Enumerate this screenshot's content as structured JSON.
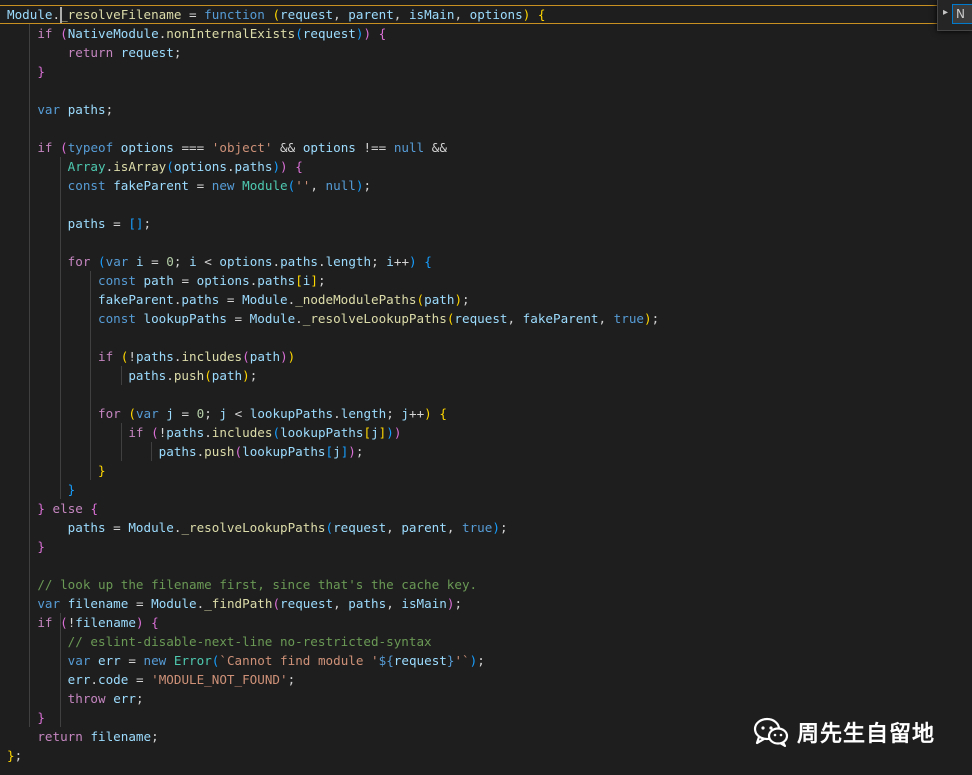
{
  "editor": {
    "language": "javascript",
    "theme_background": "#1e1e1e",
    "current_line_border": "#c89020",
    "lines": [
      [
        [
          "vr",
          "Module"
        ],
        [
          "op",
          "."
        ],
        [
          "fn",
          "_resolveFilename"
        ],
        [
          "op",
          " = "
        ],
        [
          "kw",
          "function"
        ],
        [
          "op",
          " "
        ],
        [
          "p1",
          "("
        ],
        [
          "vr",
          "request"
        ],
        [
          "op",
          ", "
        ],
        [
          "vr",
          "parent"
        ],
        [
          "op",
          ", "
        ],
        [
          "vr",
          "isMain"
        ],
        [
          "op",
          ", "
        ],
        [
          "vr",
          "options"
        ],
        [
          "p1",
          ")"
        ],
        [
          "op",
          " "
        ],
        [
          "p1",
          "{"
        ]
      ],
      [
        [
          "op",
          "    "
        ],
        [
          "kc",
          "if"
        ],
        [
          "op",
          " "
        ],
        [
          "p2",
          "("
        ],
        [
          "vr",
          "NativeModule"
        ],
        [
          "op",
          "."
        ],
        [
          "fn",
          "nonInternalExists"
        ],
        [
          "p3",
          "("
        ],
        [
          "vr",
          "request"
        ],
        [
          "p3",
          ")"
        ],
        [
          "p2",
          ")"
        ],
        [
          "op",
          " "
        ],
        [
          "p2",
          "{"
        ]
      ],
      [
        [
          "op",
          "        "
        ],
        [
          "kc",
          "return"
        ],
        [
          "op",
          " "
        ],
        [
          "vr",
          "request"
        ],
        [
          "op",
          ";"
        ]
      ],
      [
        [
          "op",
          "    "
        ],
        [
          "p2",
          "}"
        ]
      ],
      [
        [
          "op",
          ""
        ]
      ],
      [
        [
          "op",
          "    "
        ],
        [
          "kw",
          "var"
        ],
        [
          "op",
          " "
        ],
        [
          "vr",
          "paths"
        ],
        [
          "op",
          ";"
        ]
      ],
      [
        [
          "op",
          ""
        ]
      ],
      [
        [
          "op",
          "    "
        ],
        [
          "kc",
          "if"
        ],
        [
          "op",
          " "
        ],
        [
          "p2",
          "("
        ],
        [
          "kw",
          "typeof"
        ],
        [
          "op",
          " "
        ],
        [
          "vr",
          "options"
        ],
        [
          "op",
          " === "
        ],
        [
          "st",
          "'object'"
        ],
        [
          "op",
          " && "
        ],
        [
          "vr",
          "options"
        ],
        [
          "op",
          " !== "
        ],
        [
          "kw",
          "null"
        ],
        [
          "op",
          " &&"
        ]
      ],
      [
        [
          "op",
          "        "
        ],
        [
          "ty",
          "Array"
        ],
        [
          "op",
          "."
        ],
        [
          "fn",
          "isArray"
        ],
        [
          "p3",
          "("
        ],
        [
          "vr",
          "options"
        ],
        [
          "op",
          "."
        ],
        [
          "vr",
          "paths"
        ],
        [
          "p3",
          ")"
        ],
        [
          "p2",
          ")"
        ],
        [
          "op",
          " "
        ],
        [
          "p2",
          "{"
        ]
      ],
      [
        [
          "op",
          "        "
        ],
        [
          "kw",
          "const"
        ],
        [
          "op",
          " "
        ],
        [
          "vr",
          "fakeParent"
        ],
        [
          "op",
          " = "
        ],
        [
          "kw",
          "new"
        ],
        [
          "op",
          " "
        ],
        [
          "ty",
          "Module"
        ],
        [
          "p3",
          "("
        ],
        [
          "st",
          "''"
        ],
        [
          "op",
          ", "
        ],
        [
          "kw",
          "null"
        ],
        [
          "p3",
          ")"
        ],
        [
          "op",
          ";"
        ]
      ],
      [
        [
          "op",
          ""
        ]
      ],
      [
        [
          "op",
          "        "
        ],
        [
          "vr",
          "paths"
        ],
        [
          "op",
          " = "
        ],
        [
          "p3",
          "[]"
        ],
        [
          "op",
          ";"
        ]
      ],
      [
        [
          "op",
          ""
        ]
      ],
      [
        [
          "op",
          "        "
        ],
        [
          "kc",
          "for"
        ],
        [
          "op",
          " "
        ],
        [
          "p3",
          "("
        ],
        [
          "kw",
          "var"
        ],
        [
          "op",
          " "
        ],
        [
          "vr",
          "i"
        ],
        [
          "op",
          " = "
        ],
        [
          "nm",
          "0"
        ],
        [
          "op",
          "; "
        ],
        [
          "vr",
          "i"
        ],
        [
          "op",
          " < "
        ],
        [
          "vr",
          "options"
        ],
        [
          "op",
          "."
        ],
        [
          "vr",
          "paths"
        ],
        [
          "op",
          "."
        ],
        [
          "vr",
          "length"
        ],
        [
          "op",
          "; "
        ],
        [
          "vr",
          "i"
        ],
        [
          "op",
          "++"
        ],
        [
          "p3",
          ")"
        ],
        [
          "op",
          " "
        ],
        [
          "p3",
          "{"
        ]
      ],
      [
        [
          "op",
          "            "
        ],
        [
          "kw",
          "const"
        ],
        [
          "op",
          " "
        ],
        [
          "vr",
          "path"
        ],
        [
          "op",
          " = "
        ],
        [
          "vr",
          "options"
        ],
        [
          "op",
          "."
        ],
        [
          "vr",
          "paths"
        ],
        [
          "p1",
          "["
        ],
        [
          "vr",
          "i"
        ],
        [
          "p1",
          "]"
        ],
        [
          "op",
          ";"
        ]
      ],
      [
        [
          "op",
          "            "
        ],
        [
          "vr",
          "fakeParent"
        ],
        [
          "op",
          "."
        ],
        [
          "vr",
          "paths"
        ],
        [
          "op",
          " = "
        ],
        [
          "vr",
          "Module"
        ],
        [
          "op",
          "."
        ],
        [
          "fn",
          "_nodeModulePaths"
        ],
        [
          "p1",
          "("
        ],
        [
          "vr",
          "path"
        ],
        [
          "p1",
          ")"
        ],
        [
          "op",
          ";"
        ]
      ],
      [
        [
          "op",
          "            "
        ],
        [
          "kw",
          "const"
        ],
        [
          "op",
          " "
        ],
        [
          "vr",
          "lookupPaths"
        ],
        [
          "op",
          " = "
        ],
        [
          "vr",
          "Module"
        ],
        [
          "op",
          "."
        ],
        [
          "fn",
          "_resolveLookupPaths"
        ],
        [
          "p1",
          "("
        ],
        [
          "vr",
          "request"
        ],
        [
          "op",
          ", "
        ],
        [
          "vr",
          "fakeParent"
        ],
        [
          "op",
          ", "
        ],
        [
          "kw",
          "true"
        ],
        [
          "p1",
          ")"
        ],
        [
          "op",
          ";"
        ]
      ],
      [
        [
          "op",
          ""
        ]
      ],
      [
        [
          "op",
          "            "
        ],
        [
          "kc",
          "if"
        ],
        [
          "op",
          " "
        ],
        [
          "p1",
          "("
        ],
        [
          "op",
          "!"
        ],
        [
          "vr",
          "paths"
        ],
        [
          "op",
          "."
        ],
        [
          "fn",
          "includes"
        ],
        [
          "p2",
          "("
        ],
        [
          "vr",
          "path"
        ],
        [
          "p2",
          ")"
        ],
        [
          "p1",
          ")"
        ]
      ],
      [
        [
          "op",
          "                "
        ],
        [
          "vr",
          "paths"
        ],
        [
          "op",
          "."
        ],
        [
          "fn",
          "push"
        ],
        [
          "p1",
          "("
        ],
        [
          "vr",
          "path"
        ],
        [
          "p1",
          ")"
        ],
        [
          "op",
          ";"
        ]
      ],
      [
        [
          "op",
          ""
        ]
      ],
      [
        [
          "op",
          "            "
        ],
        [
          "kc",
          "for"
        ],
        [
          "op",
          " "
        ],
        [
          "p1",
          "("
        ],
        [
          "kw",
          "var"
        ],
        [
          "op",
          " "
        ],
        [
          "vr",
          "j"
        ],
        [
          "op",
          " = "
        ],
        [
          "nm",
          "0"
        ],
        [
          "op",
          "; "
        ],
        [
          "vr",
          "j"
        ],
        [
          "op",
          " < "
        ],
        [
          "vr",
          "lookupPaths"
        ],
        [
          "op",
          "."
        ],
        [
          "vr",
          "length"
        ],
        [
          "op",
          "; "
        ],
        [
          "vr",
          "j"
        ],
        [
          "op",
          "++"
        ],
        [
          "p1",
          ")"
        ],
        [
          "op",
          " "
        ],
        [
          "p1",
          "{"
        ]
      ],
      [
        [
          "op",
          "                "
        ],
        [
          "kc",
          "if"
        ],
        [
          "op",
          " "
        ],
        [
          "p2",
          "("
        ],
        [
          "op",
          "!"
        ],
        [
          "vr",
          "paths"
        ],
        [
          "op",
          "."
        ],
        [
          "fn",
          "includes"
        ],
        [
          "p3",
          "("
        ],
        [
          "vr",
          "lookupPaths"
        ],
        [
          "p1",
          "["
        ],
        [
          "vr",
          "j"
        ],
        [
          "p1",
          "]"
        ],
        [
          "p3",
          ")"
        ],
        [
          "p2",
          ")"
        ]
      ],
      [
        [
          "op",
          "                    "
        ],
        [
          "vr",
          "paths"
        ],
        [
          "op",
          "."
        ],
        [
          "fn",
          "push"
        ],
        [
          "p2",
          "("
        ],
        [
          "vr",
          "lookupPaths"
        ],
        [
          "p3",
          "["
        ],
        [
          "vr",
          "j"
        ],
        [
          "p3",
          "]"
        ],
        [
          "p2",
          ")"
        ],
        [
          "op",
          ";"
        ]
      ],
      [
        [
          "op",
          "            "
        ],
        [
          "p1",
          "}"
        ]
      ],
      [
        [
          "op",
          "        "
        ],
        [
          "p3",
          "}"
        ]
      ],
      [
        [
          "op",
          "    "
        ],
        [
          "p2",
          "}"
        ],
        [
          "op",
          " "
        ],
        [
          "kc",
          "else"
        ],
        [
          "op",
          " "
        ],
        [
          "p2",
          "{"
        ]
      ],
      [
        [
          "op",
          "        "
        ],
        [
          "vr",
          "paths"
        ],
        [
          "op",
          " = "
        ],
        [
          "vr",
          "Module"
        ],
        [
          "op",
          "."
        ],
        [
          "fn",
          "_resolveLookupPaths"
        ],
        [
          "p3",
          "("
        ],
        [
          "vr",
          "request"
        ],
        [
          "op",
          ", "
        ],
        [
          "vr",
          "parent"
        ],
        [
          "op",
          ", "
        ],
        [
          "kw",
          "true"
        ],
        [
          "p3",
          ")"
        ],
        [
          "op",
          ";"
        ]
      ],
      [
        [
          "op",
          "    "
        ],
        [
          "p2",
          "}"
        ]
      ],
      [
        [
          "op",
          ""
        ]
      ],
      [
        [
          "op",
          "    "
        ],
        [
          "cm",
          "// look up the filename first, since that's the cache key."
        ]
      ],
      [
        [
          "op",
          "    "
        ],
        [
          "kw",
          "var"
        ],
        [
          "op",
          " "
        ],
        [
          "vr",
          "filename"
        ],
        [
          "op",
          " = "
        ],
        [
          "vr",
          "Module"
        ],
        [
          "op",
          "."
        ],
        [
          "fn",
          "_findPath"
        ],
        [
          "p2",
          "("
        ],
        [
          "vr",
          "request"
        ],
        [
          "op",
          ", "
        ],
        [
          "vr",
          "paths"
        ],
        [
          "op",
          ", "
        ],
        [
          "vr",
          "isMain"
        ],
        [
          "p2",
          ")"
        ],
        [
          "op",
          ";"
        ]
      ],
      [
        [
          "op",
          "    "
        ],
        [
          "kc",
          "if"
        ],
        [
          "op",
          " "
        ],
        [
          "p2",
          "("
        ],
        [
          "op",
          "!"
        ],
        [
          "vr",
          "filename"
        ],
        [
          "p2",
          ")"
        ],
        [
          "op",
          " "
        ],
        [
          "p2",
          "{"
        ]
      ],
      [
        [
          "op",
          "        "
        ],
        [
          "cm",
          "// eslint-disable-next-line no-restricted-syntax"
        ]
      ],
      [
        [
          "op",
          "        "
        ],
        [
          "kw",
          "var"
        ],
        [
          "op",
          " "
        ],
        [
          "vr",
          "err"
        ],
        [
          "op",
          " = "
        ],
        [
          "kw",
          "new"
        ],
        [
          "op",
          " "
        ],
        [
          "ty",
          "Error"
        ],
        [
          "p3",
          "("
        ],
        [
          "st",
          "`Cannot find module '"
        ],
        [
          "kw",
          "${"
        ],
        [
          "vr",
          "request"
        ],
        [
          "kw",
          "}"
        ],
        [
          "st",
          "'`"
        ],
        [
          "p3",
          ")"
        ],
        [
          "op",
          ";"
        ]
      ],
      [
        [
          "op",
          "        "
        ],
        [
          "vr",
          "err"
        ],
        [
          "op",
          "."
        ],
        [
          "vr",
          "code"
        ],
        [
          "op",
          " = "
        ],
        [
          "st",
          "'MODULE_NOT_FOUND'"
        ],
        [
          "op",
          ";"
        ]
      ],
      [
        [
          "op",
          "        "
        ],
        [
          "kc",
          "throw"
        ],
        [
          "op",
          " "
        ],
        [
          "vr",
          "err"
        ],
        [
          "op",
          ";"
        ]
      ],
      [
        [
          "op",
          "    "
        ],
        [
          "p2",
          "}"
        ]
      ],
      [
        [
          "op",
          "    "
        ],
        [
          "kc",
          "return"
        ],
        [
          "op",
          " "
        ],
        [
          "vr",
          "filename"
        ],
        [
          "op",
          ";"
        ]
      ],
      [
        [
          "p1",
          "}"
        ],
        [
          "op",
          ";"
        ]
      ]
    ]
  },
  "find_widget": {
    "chevron_icon": "chevron-right-icon",
    "input_value": "N"
  },
  "watermark": {
    "icon": "wechat-icon",
    "text": "周先生自留地"
  }
}
